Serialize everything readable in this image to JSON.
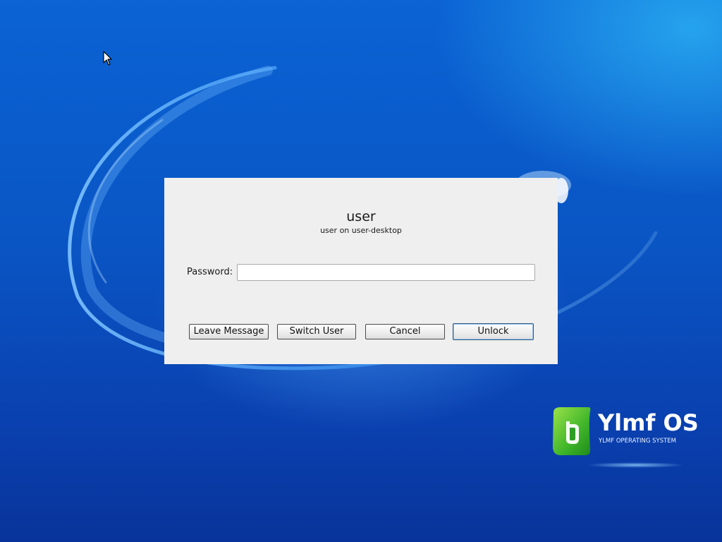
{
  "dialog": {
    "user_name": "user",
    "user_subtitle": "user on user-desktop",
    "password_label": "Password:",
    "password_value": "",
    "buttons": {
      "leave_message": "Leave Message",
      "switch_user": "Switch User",
      "cancel": "Cancel",
      "unlock": "Unlock"
    }
  },
  "branding": {
    "logo_title": "Ylmf OS",
    "logo_subtitle": "YLMF OPERATING SYSTEM"
  },
  "colors": {
    "desktop_blue": "#0a55c4",
    "dialog_bg": "#efefef",
    "logo_green": "#3fb52a"
  },
  "icons": {
    "cursor": "mouse-pointer-icon",
    "logo": "ylmf-leaf-logo-icon"
  }
}
